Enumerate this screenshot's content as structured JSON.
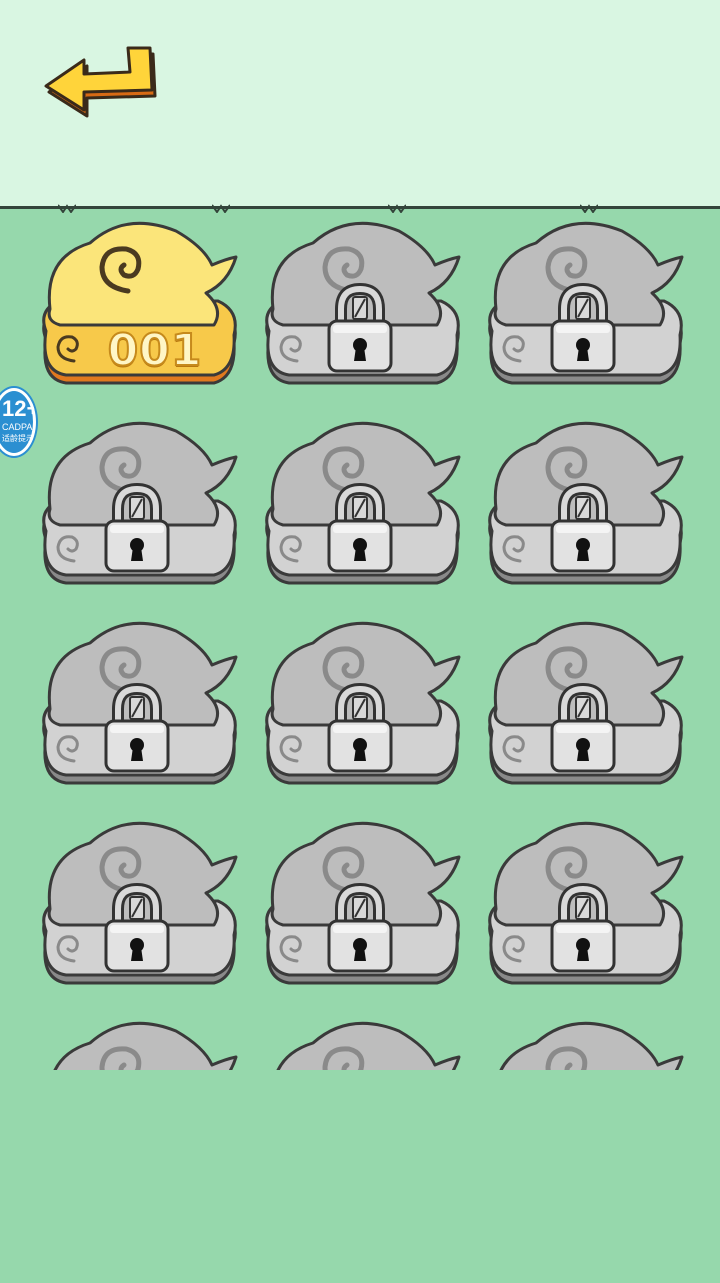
{
  "header": {
    "back_icon": "back-arrow-icon"
  },
  "age_badge": {
    "rating": "12+",
    "org": "CADPA",
    "note": "适龄提示"
  },
  "colors": {
    "unlocked_cloud": "#fbe57a",
    "unlocked_rim": "#e0791f",
    "locked_cloud": "#c8c8c8",
    "board": "#96d8ac",
    "sky": "#d9f6e2"
  },
  "levels": [
    {
      "number": "001",
      "locked": false
    },
    {
      "number": "",
      "locked": true
    },
    {
      "number": "",
      "locked": true
    },
    {
      "number": "",
      "locked": true
    },
    {
      "number": "",
      "locked": true
    },
    {
      "number": "",
      "locked": true
    },
    {
      "number": "",
      "locked": true
    },
    {
      "number": "",
      "locked": true
    },
    {
      "number": "",
      "locked": true
    },
    {
      "number": "",
      "locked": true
    },
    {
      "number": "",
      "locked": true
    },
    {
      "number": "",
      "locked": true
    },
    {
      "number": "",
      "locked": true
    },
    {
      "number": "",
      "locked": true
    },
    {
      "number": "",
      "locked": true
    }
  ]
}
